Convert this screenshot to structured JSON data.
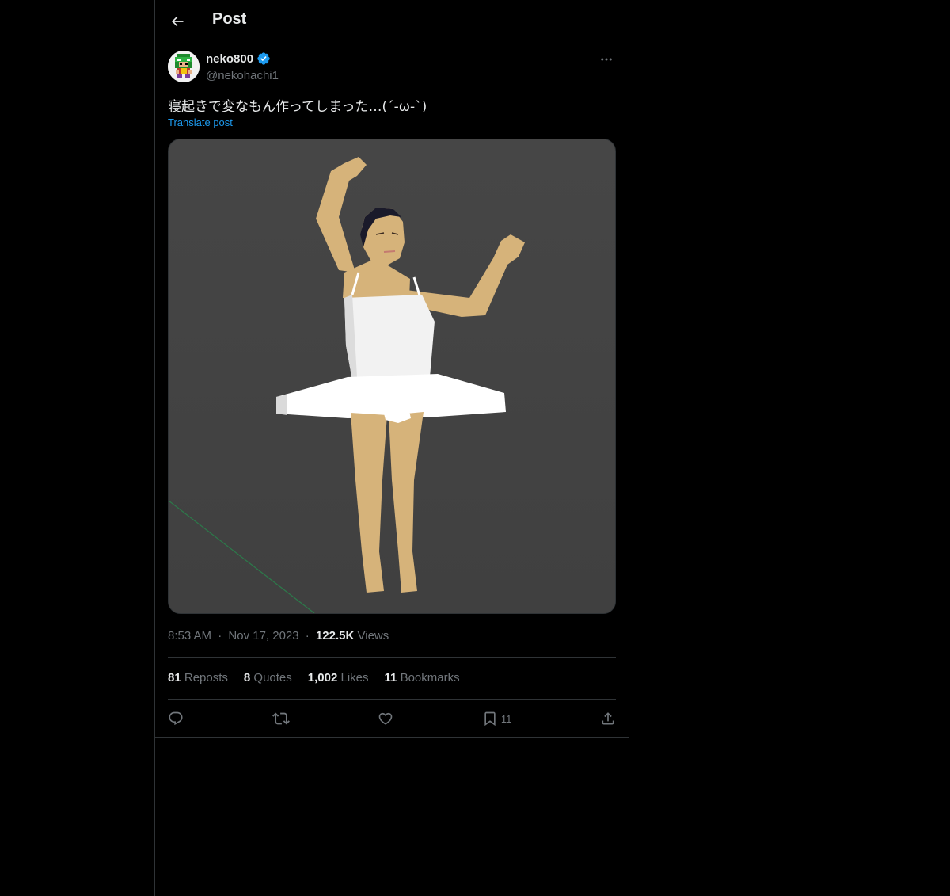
{
  "header": {
    "title": "Post",
    "back_icon": "arrow-left-icon"
  },
  "author": {
    "display_name": "neko800",
    "handle": "@nekohachi1",
    "verified_badge_color": "#1d9bf0",
    "avatar_icon": "pixel-avatar-icon"
  },
  "post": {
    "text": "寝起きで変なもん作ってしまった…(´-ω-`)",
    "translate_label": "Translate post",
    "media_description_icon": "ballerina-3d-render-image"
  },
  "meta": {
    "time": "8:53 AM",
    "separator": "·",
    "date": "Nov 17, 2023",
    "views_count": "122.5K",
    "views_label": "Views"
  },
  "stats": {
    "reposts_count": "81",
    "reposts_label": "Reposts",
    "quotes_count": "8",
    "quotes_label": "Quotes",
    "likes_count": "1,002",
    "likes_label": "Likes",
    "bookmarks_count": "11",
    "bookmarks_label": "Bookmarks"
  },
  "actions": {
    "reply_icon": "reply-icon",
    "repost_icon": "repost-icon",
    "like_icon": "heart-icon",
    "bookmark_icon": "bookmark-icon",
    "bookmark_count": "11",
    "share_icon": "share-icon"
  },
  "colors": {
    "background": "#000000",
    "text": "#e7e9ea",
    "muted": "#71767b",
    "accent": "#1d9bf0",
    "border": "#2f3336"
  }
}
